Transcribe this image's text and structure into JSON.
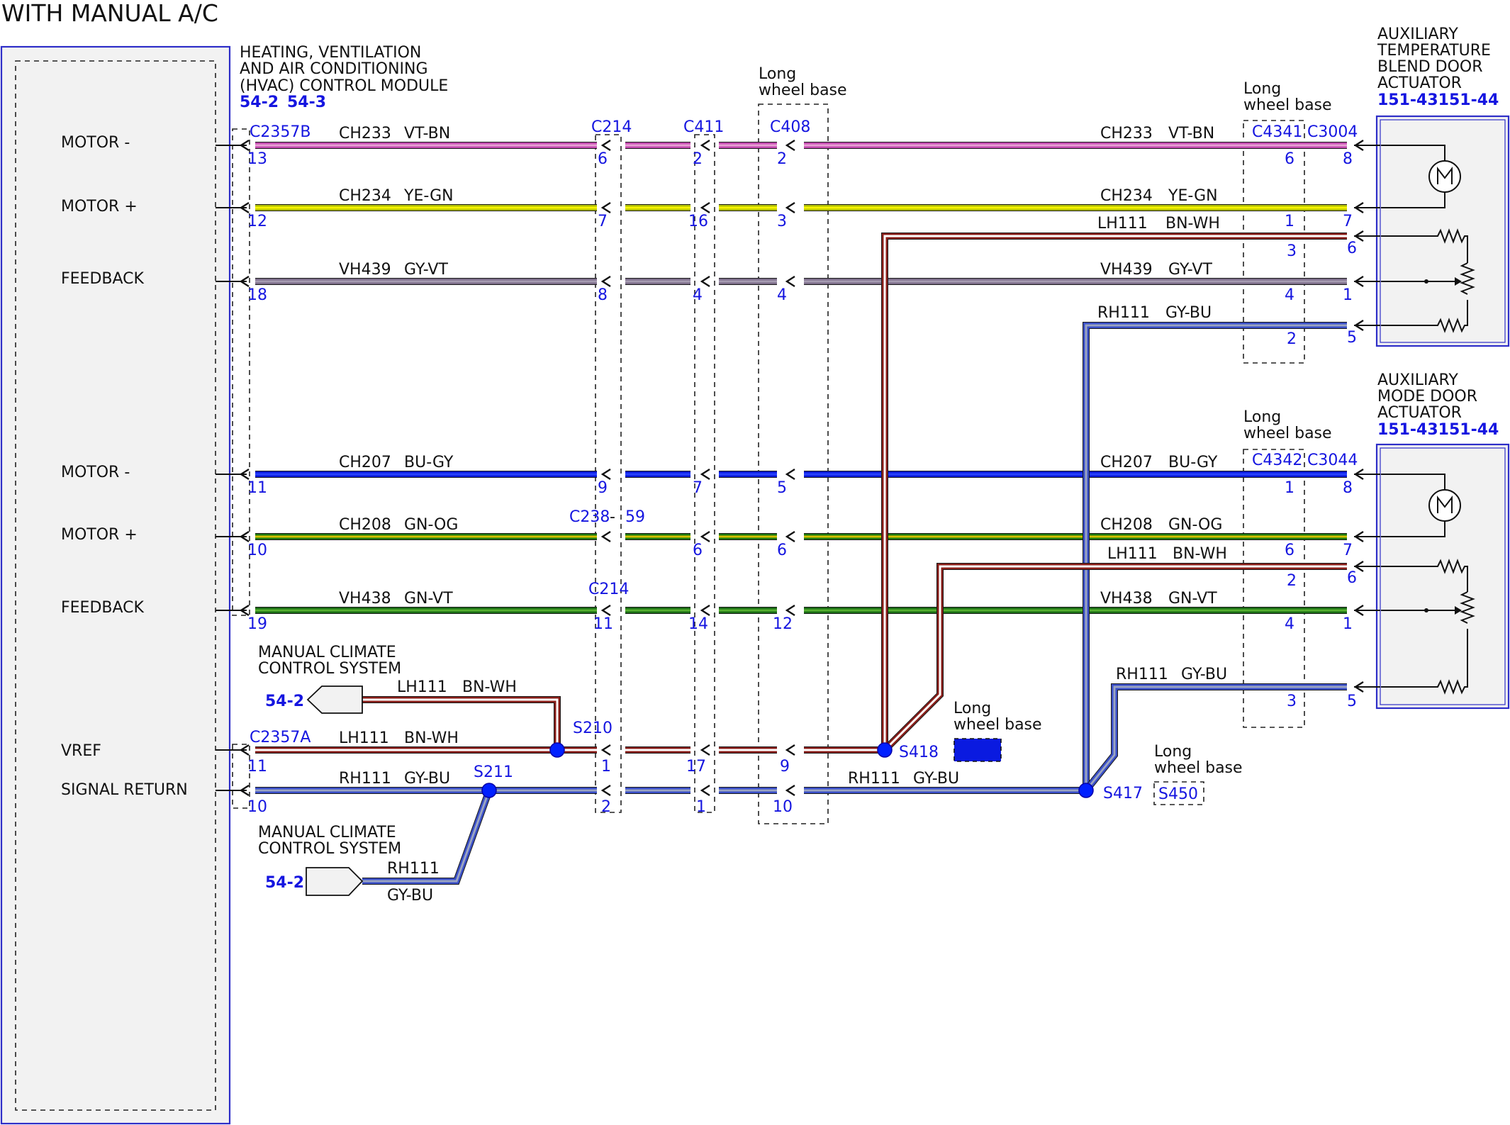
{
  "title": "WITH MANUAL A/C",
  "colors": {
    "VT-BN": [
      "#c44ab0",
      "#e9a0d4"
    ],
    "YE-GN": [
      "#b2c000",
      "#f7f400"
    ],
    "GY-VT": [
      "#7d6e8a",
      "#a69bb2"
    ],
    "BN-WH": [
      "#8a1f1a",
      "#ffffff"
    ],
    "GY-BU": [
      "#3a4fc8",
      "#9aa4c2"
    ],
    "BU-GY": [
      "#0a1ad8",
      "#2740ff"
    ],
    "GN-OG": [
      "#1f7a10",
      "#d4c200"
    ],
    "GN-VT": [
      "#1c6e16",
      "#56b030"
    ],
    "splice": "#0020ff",
    "connector_text": "#1515e0"
  },
  "hvac": {
    "lines": [
      "HEATING, VENTILATION",
      "AND AIR CONDITIONING",
      "(HVAC) CONTROL MODULE"
    ],
    "refs": [
      "54-2",
      "54-3"
    ],
    "connector_top": "C2357B",
    "connector_bottom": "C2357A"
  },
  "signals": {
    "motor_minus_1": "MOTOR -",
    "motor_plus_1": "MOTOR +",
    "feedback_1": "FEEDBACK",
    "motor_minus_2": "MOTOR -",
    "motor_plus_2": "MOTOR +",
    "feedback_2": "FEEDBACK",
    "vref": "VREF",
    "signal_return": "SIGNAL RETURN"
  },
  "actuators": {
    "temp": {
      "lines": [
        "AUXILIARY",
        "TEMPERATURE",
        "BLEND DOOR",
        "ACTUATOR"
      ],
      "ref": "151-43151-44"
    },
    "mode": {
      "lines": [
        "AUXILIARY",
        "MODE DOOR",
        "ACTUATOR"
      ],
      "ref": "151-43151-44"
    }
  },
  "connectors": {
    "c214_top": "C214",
    "c411": "C411",
    "c408": "C408",
    "c4341": "C4341",
    "c3004": "C3004",
    "c4342": "C4342",
    "c3044": "C3044",
    "c238": "C238",
    "c238_dash": "-",
    "c238_pin": "59",
    "c214_bottom": "C214"
  },
  "lwb": {
    "line1": "Long",
    "line2": "wheel base"
  },
  "wires": [
    {
      "circuit": "CH233",
      "color": "VT-BN",
      "pins": [
        "13",
        "6",
        "2",
        "2",
        "6",
        "8"
      ],
      "rcircuit": "CH233",
      "rcolor": "VT-BN"
    },
    {
      "circuit": "CH234",
      "color": "YE-GN",
      "pins": [
        "12",
        "7",
        "16",
        "3",
        "1",
        "7"
      ],
      "rcircuit": "CH234",
      "rcolor": "YE-GN"
    },
    {
      "circuit": "VH439",
      "color": "GY-VT",
      "pins": [
        "18",
        "8",
        "4",
        "4",
        "4",
        "1"
      ],
      "rcircuit": "VH439",
      "rcolor": "GY-VT"
    },
    {
      "circuit": "CH207",
      "color": "BU-GY",
      "pins": [
        "11",
        "9",
        "7",
        "5",
        "1",
        "8"
      ],
      "rcircuit": "CH207",
      "rcolor": "BU-GY"
    },
    {
      "circuit": "CH208",
      "color": "GN-OG",
      "pins": [
        "10",
        "",
        "6",
        "6",
        "6",
        "7"
      ],
      "rcircuit": "CH208",
      "rcolor": "GN-OG"
    },
    {
      "circuit": "VH438",
      "color": "GN-VT",
      "pins": [
        "19",
        "11",
        "14",
        "12",
        "4",
        "1"
      ],
      "rcircuit": "VH438",
      "rcolor": "GN-VT"
    }
  ],
  "branch": {
    "lh_top": {
      "circuit": "LH111",
      "color": "BN-WH",
      "pins": [
        "3",
        "6"
      ]
    },
    "rh_top": {
      "circuit": "RH111",
      "color": "GY-BU",
      "pins": [
        "2",
        "5"
      ]
    },
    "lh_mid": {
      "circuit": "LH111",
      "color": "BN-WH",
      "pins": [
        "2",
        "6"
      ]
    },
    "rh_mid": {
      "circuit": "RH111",
      "color": "GY-BU",
      "pins": [
        "3",
        "5"
      ]
    }
  },
  "vref": {
    "circuit": "LH111",
    "color": "BN-WH",
    "pins": [
      "11",
      "1",
      "17",
      "9"
    ]
  },
  "sigret": {
    "circuit": "RH111",
    "color": "GY-BU",
    "pins": [
      "10",
      "2",
      "1",
      "10"
    ],
    "rcircuit": "RH111",
    "rcolor": "GY-BU"
  },
  "splices": {
    "s210": "S210",
    "s211": "S211",
    "s418": "S418",
    "s417": "S417",
    "s450": "S450"
  },
  "manual": {
    "line1": "MANUAL CLIMATE",
    "line2": "CONTROL SYSTEM",
    "ref": "54-2",
    "lh_circuit": "LH111",
    "lh_color": "BN-WH",
    "rh_circuit": "RH111",
    "rh_color": "GY-BU"
  }
}
